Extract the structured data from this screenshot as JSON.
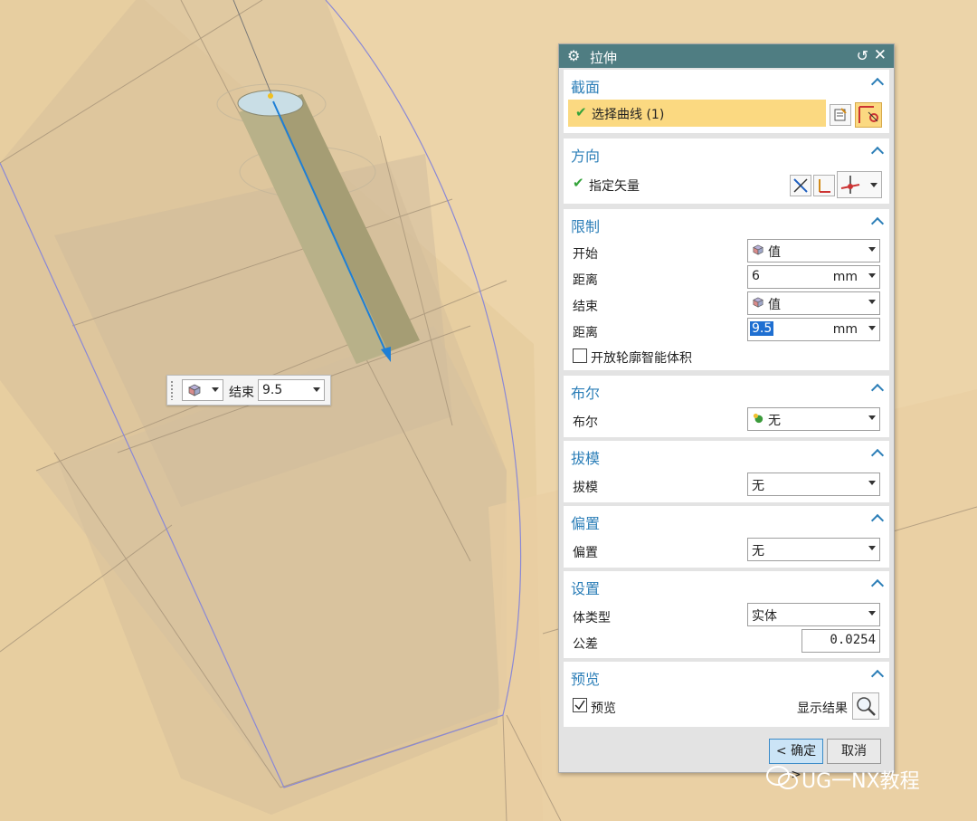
{
  "dialog": {
    "title": "拉伸",
    "sections": {
      "section": {
        "title": "截面",
        "select_curve": "选择曲线 (1)"
      },
      "direction": {
        "title": "方向",
        "vector_label": "指定矢量"
      },
      "limits": {
        "title": "限制",
        "start_label": "开始",
        "start_type": "值",
        "start_distance_label": "距离",
        "start_distance": "6",
        "start_unit": "mm",
        "end_label": "结束",
        "end_type": "值",
        "end_distance_label": "距离",
        "end_distance": "9.5",
        "end_unit": "mm",
        "open_profile_label": "开放轮廓智能体积"
      },
      "boolean": {
        "title": "布尔",
        "label": "布尔",
        "value": "无"
      },
      "draft": {
        "title": "拔模",
        "label": "拔模",
        "value": "无"
      },
      "offset": {
        "title": "偏置",
        "label": "偏置",
        "value": "无"
      },
      "settings": {
        "title": "设置",
        "body_type_label": "体类型",
        "body_type": "实体",
        "tolerance_label": "公差",
        "tolerance": "0.0254"
      },
      "preview": {
        "title": "预览",
        "preview_label": "预览",
        "show_result_label": "显示结果",
        "preview_checked": true
      }
    },
    "ok_label": "< 确定 >",
    "cancel_label": "取消"
  },
  "float_bar": {
    "label": "结束",
    "value": "9.5"
  },
  "watermark": {
    "text": "UG一NX教程"
  },
  "colors": {
    "titlebar": "#4f7d82",
    "accent": "#2d7fb8",
    "selected_row": "#fbd981",
    "check": "#34a33a"
  }
}
